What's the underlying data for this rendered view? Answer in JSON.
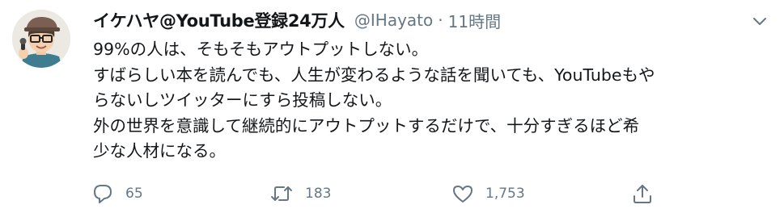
{
  "tweet": {
    "author_name": "イケハヤ@YouTube登録24万人",
    "handle": "@IHayato",
    "separator": "·",
    "timestamp": "11時間",
    "body_lines": [
      "99%の人は、そもそもアウトプットしない。",
      "すばらしい本を読んでも、人生が変わるような話を聞いても、YouTubeもや",
      "らないしツイッターにすら投稿しない。",
      "外の世界を意識して継続的にアウトプットするだけで、十分すぎるほど希",
      "少な人材になる。"
    ],
    "actions": {
      "reply_count": "65",
      "retweet_count": "183",
      "like_count": "1,753"
    }
  },
  "icons": {
    "more": "chevron-down-icon",
    "reply": "speech-bubble-icon",
    "retweet": "retweet-arrows-icon",
    "like": "heart-icon",
    "share": "share-upload-icon"
  },
  "colors": {
    "text": "#14171a",
    "secondary": "#657786",
    "background": "#ffffff"
  }
}
